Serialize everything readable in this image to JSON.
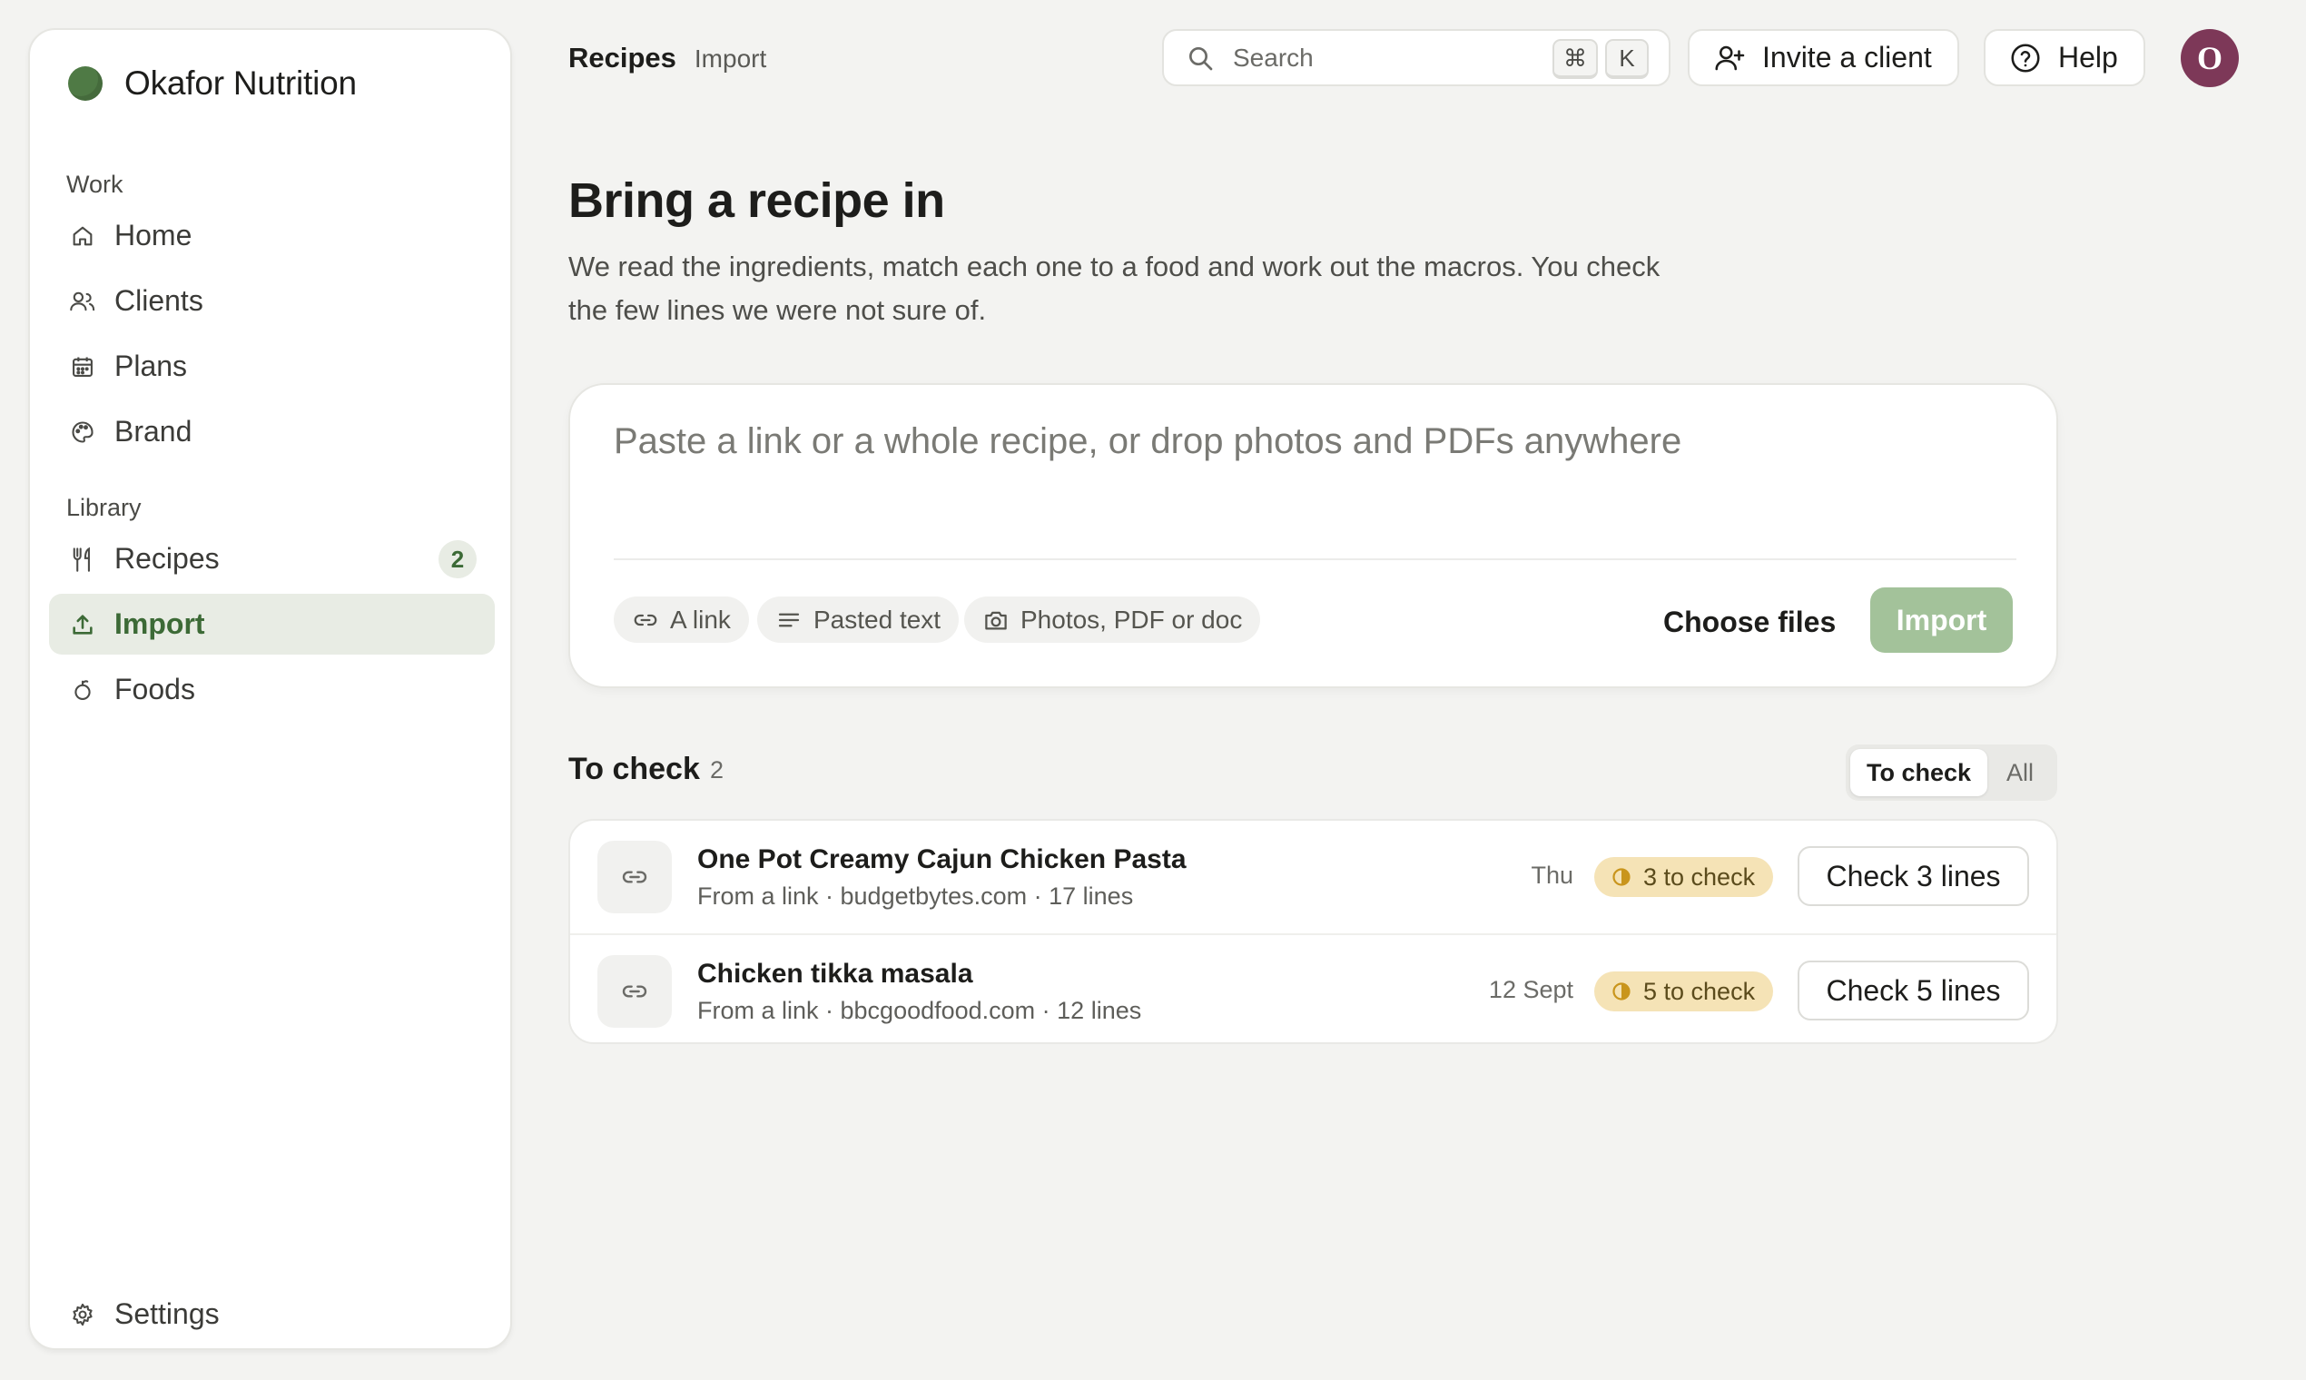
{
  "brand": {
    "name": "Okafor Nutrition"
  },
  "sidebar": {
    "sections": [
      {
        "label": "Work"
      },
      {
        "label": "Library"
      }
    ],
    "items": [
      {
        "label": "Home",
        "icon": "home-icon"
      },
      {
        "label": "Clients",
        "icon": "users-icon"
      },
      {
        "label": "Plans",
        "icon": "calendar-icon"
      },
      {
        "label": "Brand",
        "icon": "palette-icon"
      },
      {
        "label": "Recipes",
        "icon": "utensils-icon",
        "badge": "2"
      },
      {
        "label": "Import",
        "icon": "upload-icon",
        "active": true
      },
      {
        "label": "Foods",
        "icon": "apple-icon"
      }
    ],
    "settings": {
      "label": "Settings",
      "icon": "gear-icon"
    }
  },
  "topbar": {
    "breadcrumb": {
      "main": "Recipes",
      "sub": "Import"
    },
    "search": {
      "placeholder": "Search",
      "shortcut_mod": "⌘",
      "shortcut_key": "K"
    },
    "invite_label": "Invite a client",
    "help_label": "Help",
    "avatar_initial": "O"
  },
  "page": {
    "title": "Bring a recipe in",
    "description": "We read the ingredients, match each one to a food and work out the macros. You check the few lines we were not sure of."
  },
  "import_card": {
    "placeholder": "Paste a link or a whole recipe, or drop photos and PDFs anywhere",
    "chips": [
      {
        "label": "A link",
        "icon": "link-icon"
      },
      {
        "label": "Pasted text",
        "icon": "text-lines-icon"
      },
      {
        "label": "Photos, PDF or doc",
        "icon": "camera-icon"
      }
    ],
    "choose_files_label": "Choose files",
    "import_label": "Import"
  },
  "to_check": {
    "title": "To check",
    "count": "2",
    "filters": {
      "active": "To check",
      "other": "All"
    },
    "rows": [
      {
        "title": "One Pot Creamy Cajun Chicken Pasta",
        "meta": "From a link · budgetbytes.com · 17 lines",
        "date": "Thu",
        "badge": "3 to check",
        "action": "Check 3 lines"
      },
      {
        "title": "Chicken tikka masala",
        "meta": "From a link · bbcgoodfood.com · 12 lines",
        "date": "12 Sept",
        "badge": "5 to check",
        "action": "Check 5 lines"
      }
    ]
  },
  "colors": {
    "accent": "#3c6a36",
    "brand_dot": "#4f7a45",
    "import_button": "#a3c29a",
    "warning_badge": "#f5e3b6",
    "avatar": "#7d3858",
    "background": "#f3f3f1"
  }
}
